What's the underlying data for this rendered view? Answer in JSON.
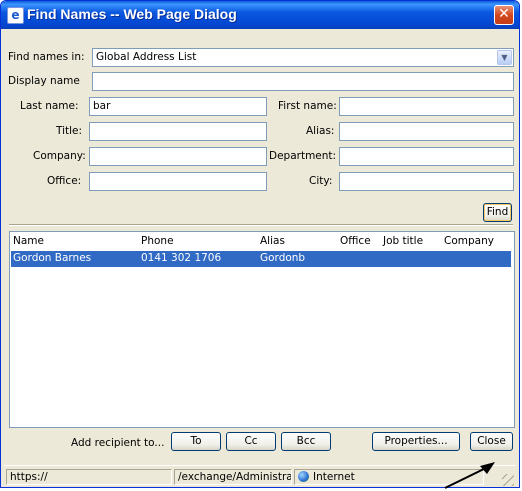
{
  "window": {
    "title": "Find Names -- Web Page Dialog",
    "title_icon": "ie-page-icon",
    "close_glyph": "✕"
  },
  "form": {
    "find_names_in_label": "Find names in:",
    "find_names_in_value": "Global Address List",
    "display_name_label": "Display name",
    "display_name_value": "",
    "last_name_label": "Last name:",
    "last_name_value": "bar",
    "first_name_label": "First name:",
    "first_name_value": "",
    "title_label": "Title:",
    "title_value": "",
    "alias_label": "Alias:",
    "alias_value": "",
    "company_label": "Company:",
    "company_value": "",
    "department_label": "Department:",
    "department_value": "",
    "office_label": "Office:",
    "office_value": "",
    "city_label": "City:",
    "city_value": "",
    "find_button": "Find"
  },
  "results": {
    "columns": [
      "Name",
      "Phone",
      "Alias",
      "Office",
      "Job title",
      "Company"
    ],
    "rows": [
      {
        "name": "Gordon Barnes",
        "phone": "0141 302 1706",
        "alias": "Gordonb",
        "office": "",
        "job_title": "",
        "company": "",
        "selected": true
      }
    ]
  },
  "actions": {
    "add_recipient_label": "Add recipient to...",
    "to_button": "To",
    "cc_button": "Cc",
    "bcc_button": "Bcc",
    "properties_button": "Properties...",
    "close_button": "Close"
  },
  "statusbar": {
    "url": "https://",
    "path": "/exchange/Administrat",
    "zone": "Internet"
  },
  "colors": {
    "titlebar": "#0a58e0",
    "selection": "#316ac5",
    "dialog_face": "#ece9d8"
  }
}
